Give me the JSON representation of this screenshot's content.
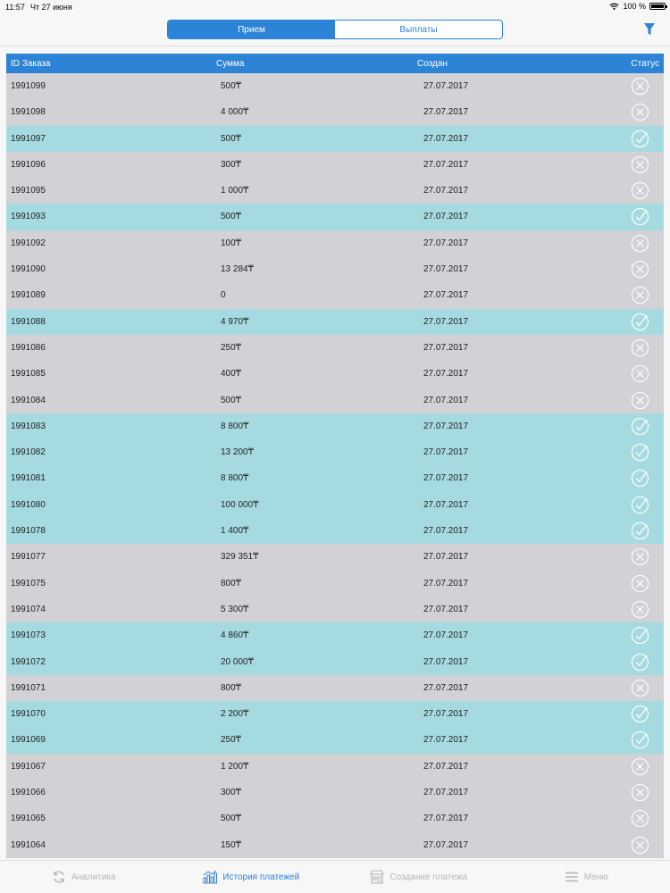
{
  "status_bar": {
    "time": "11:57",
    "date": "Чт 27 июня",
    "battery": "100 %"
  },
  "segmented": {
    "tab1": "Прием",
    "tab2": "Выплаты"
  },
  "table": {
    "headers": {
      "id": "ID Заказа",
      "sum": "Сумма",
      "created": "Создан",
      "status": "Статус"
    },
    "rows": [
      {
        "id": "1991099",
        "sum": "500₸",
        "date": "27.07.2017",
        "status": "fail"
      },
      {
        "id": "1991098",
        "sum": "4 000₸",
        "date": "27.07.2017",
        "status": "fail"
      },
      {
        "id": "1991097",
        "sum": "500₸",
        "date": "27.07.2017",
        "status": "ok"
      },
      {
        "id": "1991096",
        "sum": "300₸",
        "date": "27.07.2017",
        "status": "fail"
      },
      {
        "id": "1991095",
        "sum": "1 000₸",
        "date": "27.07.2017",
        "status": "fail"
      },
      {
        "id": "1991093",
        "sum": "500₸",
        "date": "27.07.2017",
        "status": "ok"
      },
      {
        "id": "1991092",
        "sum": "100₸",
        "date": "27.07.2017",
        "status": "fail"
      },
      {
        "id": "1991090",
        "sum": "13 284₸",
        "date": "27.07.2017",
        "status": "fail"
      },
      {
        "id": "1991089",
        "sum": "0",
        "date": "27.07.2017",
        "status": "fail"
      },
      {
        "id": "1991088",
        "sum": "4 970₸",
        "date": "27.07.2017",
        "status": "ok"
      },
      {
        "id": "1991086",
        "sum": "250₸",
        "date": "27.07.2017",
        "status": "fail"
      },
      {
        "id": "1991085",
        "sum": "400₸",
        "date": "27.07.2017",
        "status": "fail"
      },
      {
        "id": "1991084",
        "sum": "500₸",
        "date": "27.07.2017",
        "status": "fail"
      },
      {
        "id": "1991083",
        "sum": "8 800₸",
        "date": "27.07.2017",
        "status": "ok"
      },
      {
        "id": "1991082",
        "sum": "13 200₸",
        "date": "27.07.2017",
        "status": "ok"
      },
      {
        "id": "1991081",
        "sum": "8 800₸",
        "date": "27.07.2017",
        "status": "ok"
      },
      {
        "id": "1991080",
        "sum": "100 000₸",
        "date": "27.07.2017",
        "status": "ok"
      },
      {
        "id": "1991078",
        "sum": "1 400₸",
        "date": "27.07.2017",
        "status": "ok"
      },
      {
        "id": "1991077",
        "sum": "329 351₸",
        "date": "27.07.2017",
        "status": "fail"
      },
      {
        "id": "1991075",
        "sum": "800₸",
        "date": "27.07.2017",
        "status": "fail"
      },
      {
        "id": "1991074",
        "sum": "5 300₸",
        "date": "27.07.2017",
        "status": "fail"
      },
      {
        "id": "1991073",
        "sum": "4 860₸",
        "date": "27.07.2017",
        "status": "ok"
      },
      {
        "id": "1991072",
        "sum": "20 000₸",
        "date": "27.07.2017",
        "status": "ok"
      },
      {
        "id": "1991071",
        "sum": "800₸",
        "date": "27.07.2017",
        "status": "fail"
      },
      {
        "id": "1991070",
        "sum": "2 200₸",
        "date": "27.07.2017",
        "status": "ok"
      },
      {
        "id": "1991069",
        "sum": "250₸",
        "date": "27.07.2017",
        "status": "ok"
      },
      {
        "id": "1991067",
        "sum": "1 200₸",
        "date": "27.07.2017",
        "status": "fail"
      },
      {
        "id": "1991066",
        "sum": "300₸",
        "date": "27.07.2017",
        "status": "fail"
      },
      {
        "id": "1991065",
        "sum": "500₸",
        "date": "27.07.2017",
        "status": "fail"
      },
      {
        "id": "1991064",
        "sum": "150₸",
        "date": "27.07.2017",
        "status": "fail"
      }
    ]
  },
  "tabbar": {
    "items": [
      {
        "label": "Аналитика",
        "icon": "refresh-icon"
      },
      {
        "label": "История платежей",
        "icon": "bar-chart-icon"
      },
      {
        "label": "Создание платежа",
        "icon": "store-icon"
      },
      {
        "label": "Меню",
        "icon": "menu-icon"
      }
    ]
  },
  "colors": {
    "accent": "#2d84d6",
    "row_ok": "#a5dbe0",
    "row_fail": "#d1d1d6"
  }
}
